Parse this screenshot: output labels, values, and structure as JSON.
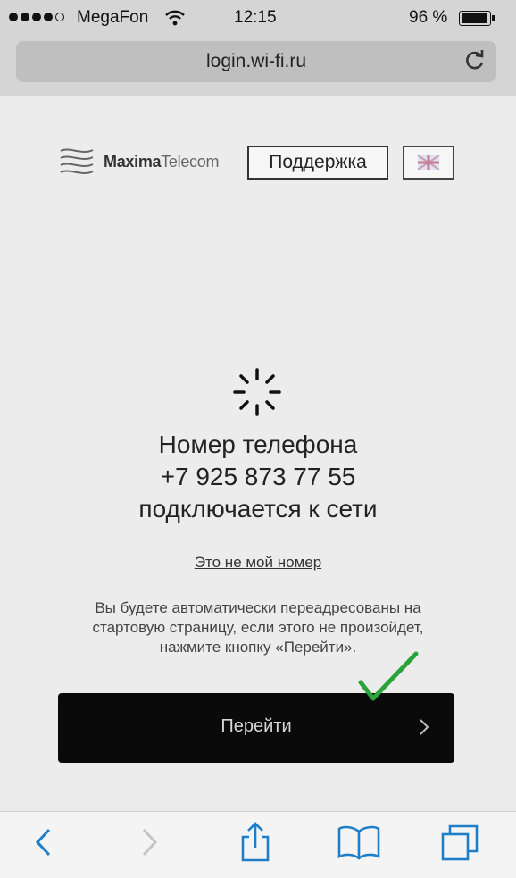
{
  "status_bar": {
    "carrier": "MegaFon",
    "time": "12:15",
    "battery": "96 %",
    "signal_bars": 4
  },
  "browser": {
    "url": "login.wi-fi.ru"
  },
  "header": {
    "logo_bold": "Maxima",
    "logo_light": "Telecom",
    "support_label": "Поддержка"
  },
  "main": {
    "phone_line1": "Номер телефона",
    "phone_line2": "+7 925 873 77 55",
    "phone_line3": "подключается к сети",
    "not_my_number": "Это не мой номер",
    "info_text": "Вы будете автоматически переадресованы на стартовую страницу, если этого не произойдет, нажмите кнопку «Перейти».",
    "go_label": "Перейти"
  },
  "toolbar": {
    "icons": [
      "back-icon",
      "forward-icon",
      "share-icon",
      "bookmarks-icon",
      "tabs-icon"
    ]
  },
  "colors": {
    "accent": "#1e7ec8",
    "button_bg": "#0a0a0a",
    "check": "#2aa43a"
  }
}
